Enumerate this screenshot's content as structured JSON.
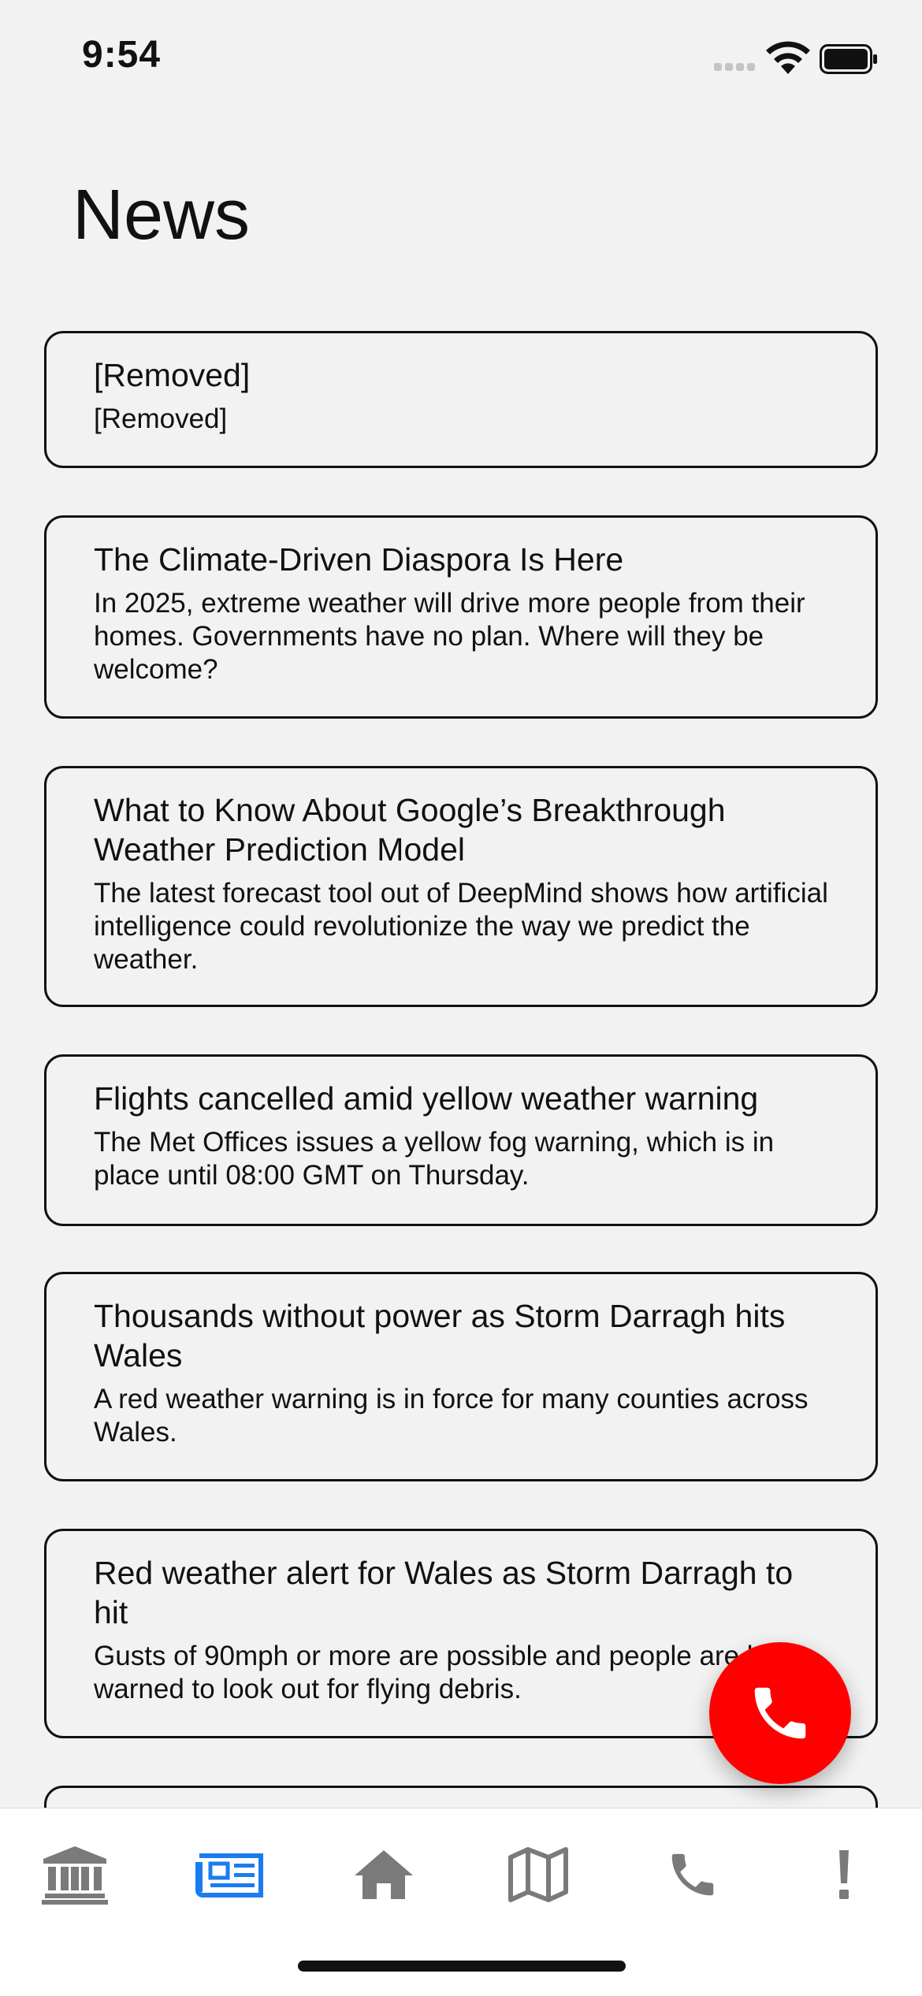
{
  "status_bar": {
    "time": "9:54"
  },
  "page": {
    "title": "News"
  },
  "news": [
    {
      "title": "[Removed]",
      "summary": "[Removed]"
    },
    {
      "title": "The Climate-Driven Diaspora Is Here",
      "summary": "In 2025, extreme weather will drive more people from their homes. Governments have no plan. Where will they be welcome?"
    },
    {
      "title": "What to Know About Google’s Breakthrough Weather Prediction Model",
      "summary": "The latest forecast tool out of DeepMind shows how artificial intelligence could revolutionize the way we predict the weather."
    },
    {
      "title": "Flights cancelled amid yellow weather warning",
      "summary": "The Met Offices issues a yellow fog warning, which is in place until 08:00 GMT on Thursday."
    },
    {
      "title": "Thousands without power as Storm Darragh hits Wales",
      "summary": "A red weather warning is in force for many counties across Wales."
    },
    {
      "title": "Red weather alert for Wales as Storm Darragh to hit",
      "summary": "Gusts of 90mph or more are possible and people are being warned to look out for flying debris."
    }
  ],
  "fab": {
    "icon": "phone-icon",
    "color": "#ff0000"
  },
  "tab_bar": {
    "active_color": "#1a7cf0",
    "inactive_color": "#7a7a7a",
    "tabs": [
      {
        "icon": "bank-icon",
        "active": false
      },
      {
        "icon": "newspaper-icon",
        "active": true
      },
      {
        "icon": "home-icon",
        "active": false
      },
      {
        "icon": "map-icon",
        "active": false
      },
      {
        "icon": "phone-icon",
        "active": false
      },
      {
        "icon": "exclamation-icon",
        "active": false
      }
    ]
  }
}
